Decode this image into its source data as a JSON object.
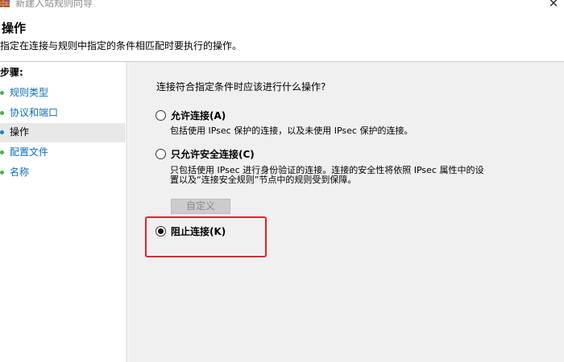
{
  "window": {
    "title": "新建入站规则向导",
    "close_glyph": "✕"
  },
  "header": {
    "title": "操作",
    "description": "指定在连接与规则中指定的条件相匹配时要执行的操作。"
  },
  "sidebar": {
    "steps_label": "步骤:",
    "items": [
      {
        "label": "规则类型"
      },
      {
        "label": "协议和端口"
      },
      {
        "label": "操作"
      },
      {
        "label": "配置文件"
      },
      {
        "label": "名称"
      }
    ]
  },
  "main": {
    "question": "连接符合指定条件时应该进行什么操作?",
    "options": [
      {
        "label": "允许连接(A)",
        "desc1": "包括使用 IPsec 保护的连接，以及未使用 IPsec 保护的连接。",
        "selected": false
      },
      {
        "label": "只允许安全连接(C)",
        "desc1": "只包括使用 IPsec 进行身份验证的连接。连接的安全性将依照 IPsec 属性中的设",
        "desc2": "置以及“连接安全规则”节点中的规则受到保障。",
        "selected": false
      },
      {
        "label": "阻止连接(K)",
        "selected": true
      }
    ],
    "customize_label": "自定义"
  },
  "colors": {
    "highlight": "#e0262c",
    "link": "#0b6fb8",
    "panel_bg": "#f0f0f0"
  },
  "icons": {
    "title": "firewall-icon",
    "close": "close-icon"
  }
}
